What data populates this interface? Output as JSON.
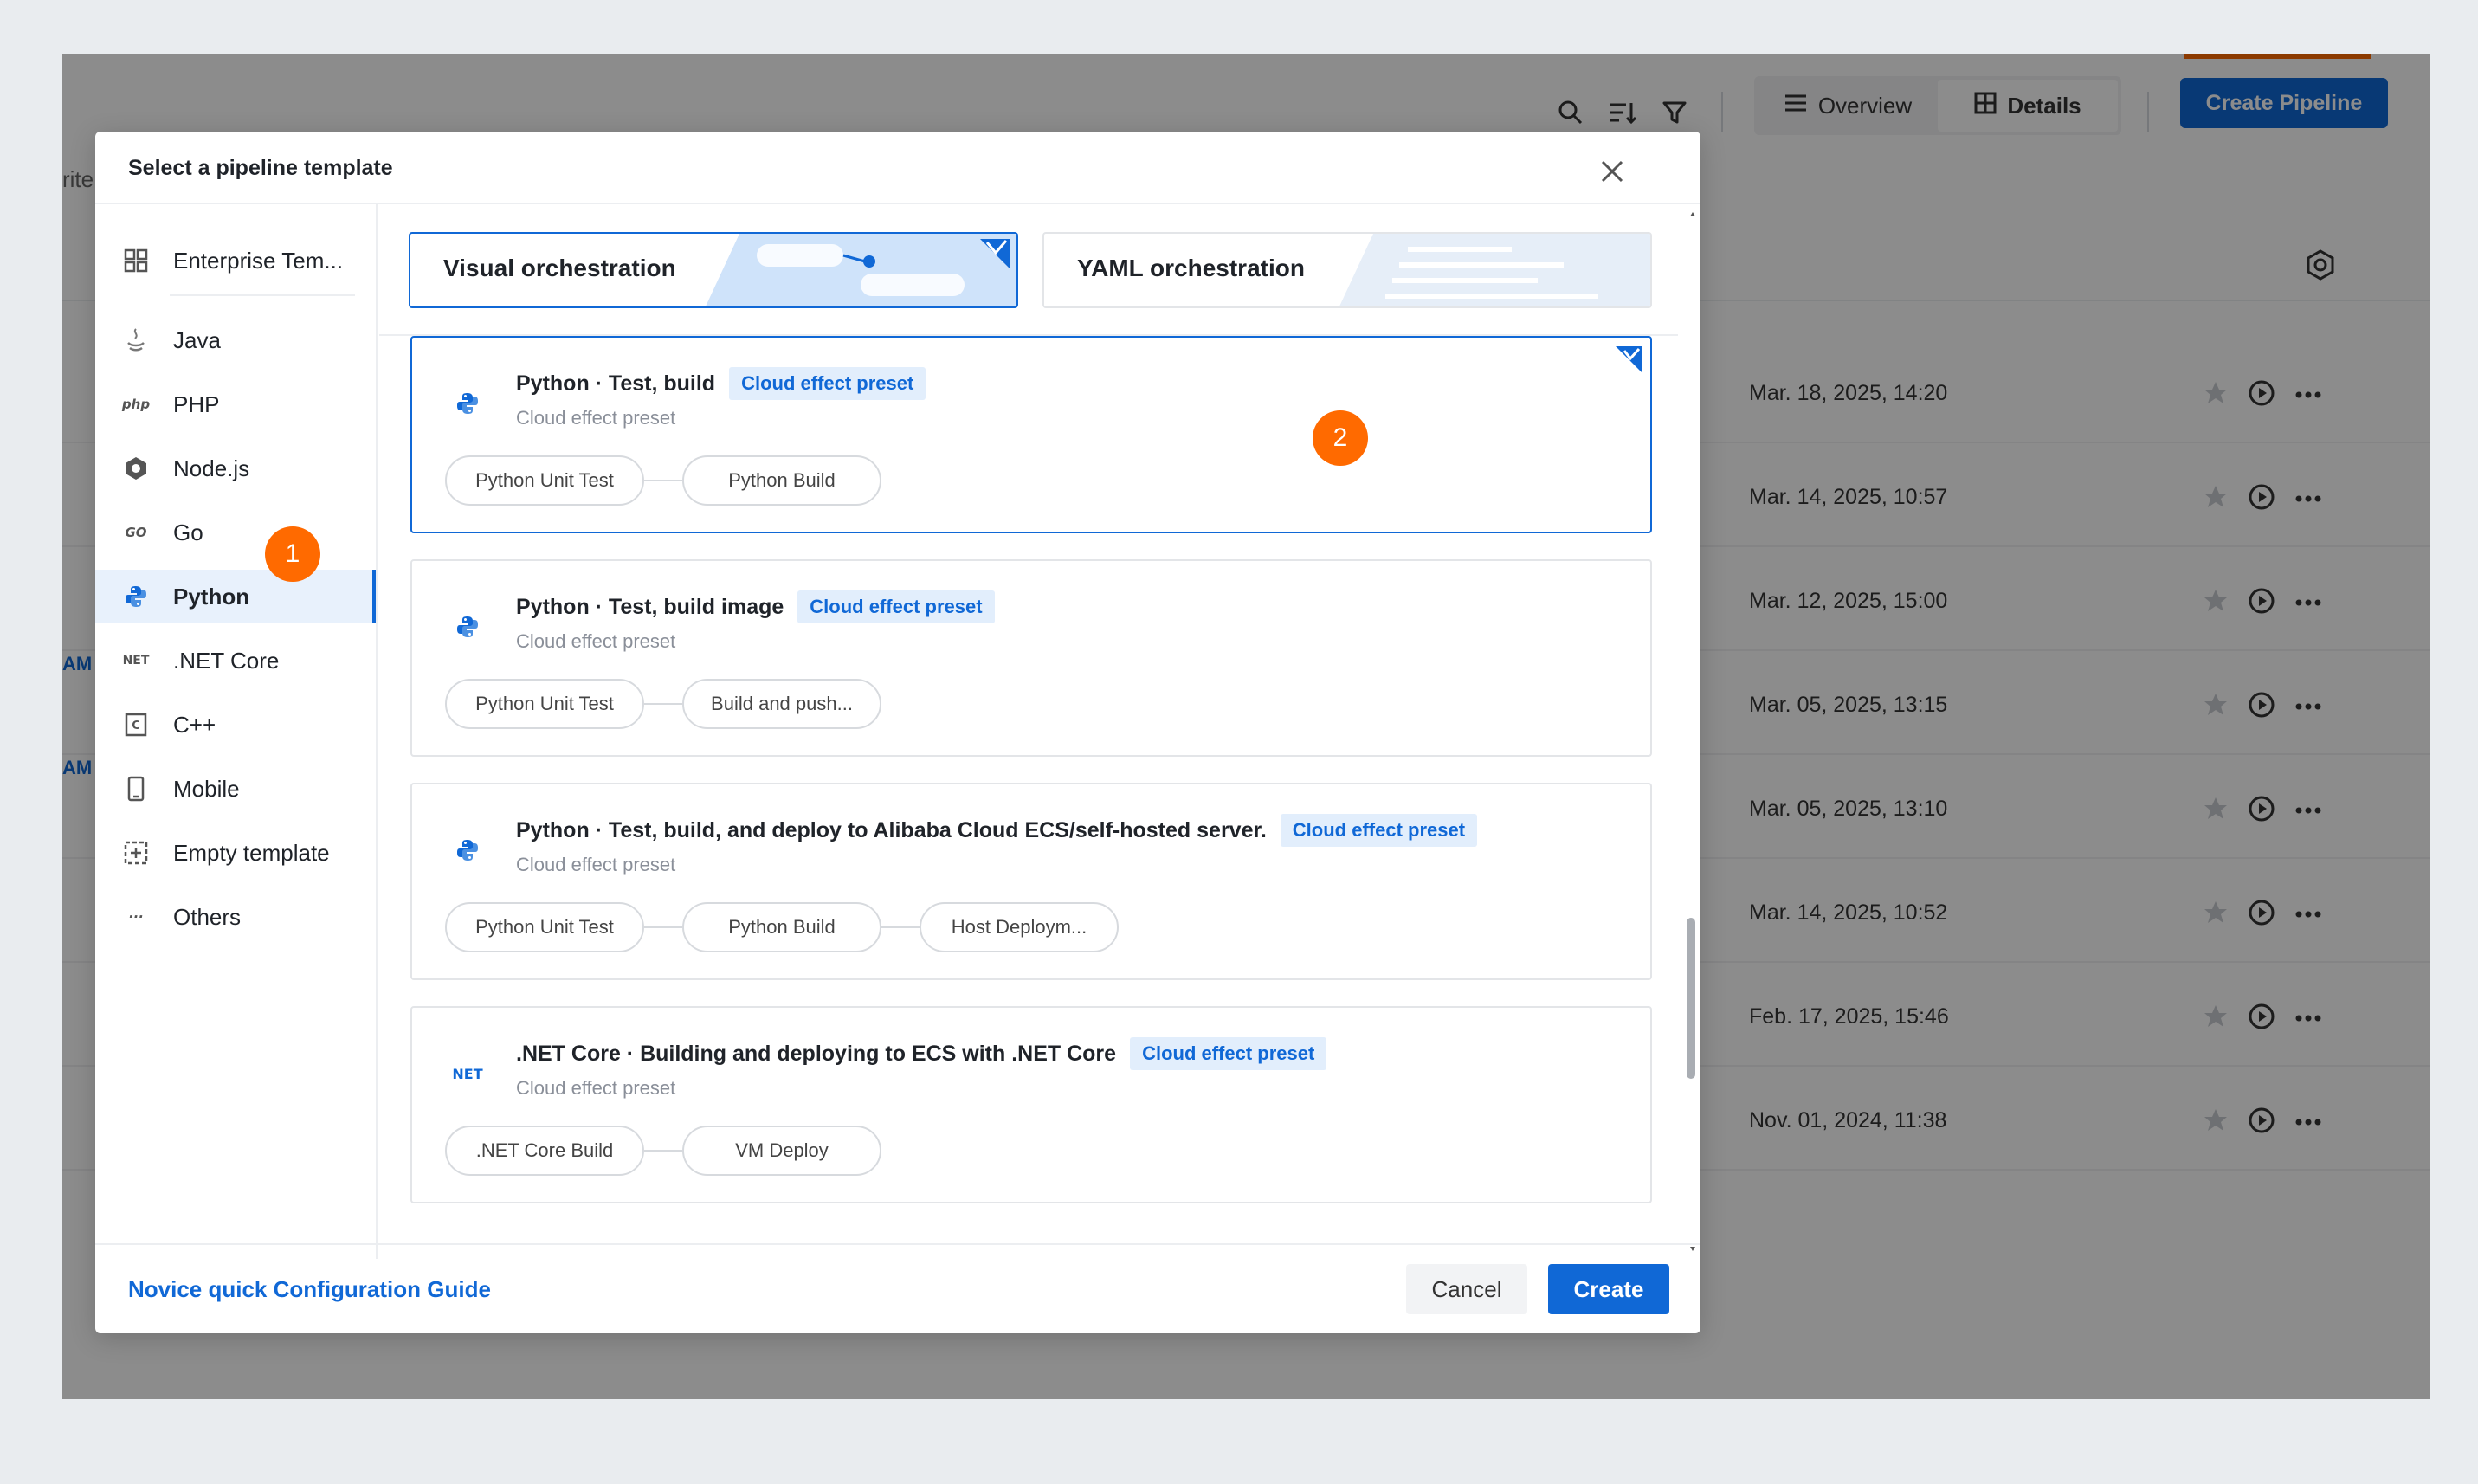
{
  "colors": {
    "accent": "#1068d6",
    "marker": "#ff6a00",
    "selected_bg": "#e8f1fc"
  },
  "background_app": {
    "view_switch": {
      "overview_label": "Overview",
      "details_label": "Details"
    },
    "create_pipeline_label": "Create Pipeline",
    "left_fragment": "rite",
    "left_tags": [
      "AM",
      "AM"
    ],
    "rows": [
      {
        "date": "Mar. 18, 2025, 14:20"
      },
      {
        "date": "Mar. 14, 2025, 10:57"
      },
      {
        "date": "Mar. 12, 2025, 15:00"
      },
      {
        "date": "Mar. 05, 2025, 13:15"
      },
      {
        "date": "Mar. 05, 2025, 13:10"
      },
      {
        "date": "Mar. 14, 2025, 10:52"
      },
      {
        "date": "Feb. 17, 2025, 15:46"
      },
      {
        "date": "Nov. 01, 2024, 11:38"
      }
    ]
  },
  "modal": {
    "title": "Select a pipeline template",
    "sidebar": {
      "items": [
        {
          "label": "Enterprise Tem...",
          "icon": "grid-icon"
        },
        {
          "label": "Java",
          "icon": "java-icon"
        },
        {
          "label": "PHP",
          "icon": "php-icon",
          "glyph": "php"
        },
        {
          "label": "Node.js",
          "icon": "nodejs-icon"
        },
        {
          "label": "Go",
          "icon": "go-icon",
          "glyph": "GO"
        },
        {
          "label": "Python",
          "icon": "python-icon",
          "active": true
        },
        {
          "label": ".NET Core",
          "icon": "dotnet-icon",
          "glyph": "NET"
        },
        {
          "label": "C++",
          "icon": "cpp-icon",
          "glyph": "C"
        },
        {
          "label": "Mobile",
          "icon": "mobile-icon"
        },
        {
          "label": "Empty template",
          "icon": "add-template-icon"
        },
        {
          "label": "Others",
          "icon": "more-icon",
          "glyph": "···"
        }
      ]
    },
    "modes": [
      {
        "label": "Visual orchestration",
        "selected": true
      },
      {
        "label": "YAML orchestration",
        "selected": false
      }
    ],
    "templates": [
      {
        "name": "Python · Test, build",
        "tag": "Cloud effect preset",
        "subtitle": "Cloud effect preset",
        "icon": "python-icon",
        "steps": [
          "Python Unit Test",
          "Python Build"
        ],
        "selected": true
      },
      {
        "name": "Python · Test, build image",
        "tag": "Cloud effect preset",
        "subtitle": "Cloud effect preset",
        "icon": "python-icon",
        "steps": [
          "Python Unit Test",
          "Build and push..."
        ],
        "selected": false
      },
      {
        "name": "Python · Test, build, and deploy to Alibaba Cloud ECS/self-hosted server.",
        "tag": "Cloud effect preset",
        "subtitle": "Cloud effect preset",
        "icon": "python-icon",
        "steps": [
          "Python Unit Test",
          "Python Build",
          "Host Deploym..."
        ],
        "selected": false
      },
      {
        "name": ".NET Core · Building and deploying to ECS with .NET Core",
        "tag": "Cloud effect preset",
        "subtitle": "Cloud effect preset",
        "icon": "dotnet-icon",
        "icon_text": "NET",
        "steps": [
          ".NET Core Build",
          "VM Deploy"
        ],
        "selected": false
      }
    ],
    "footer": {
      "guide_link": "Novice quick Configuration Guide",
      "cancel_label": "Cancel",
      "create_label": "Create"
    }
  },
  "markers": [
    "1",
    "2"
  ]
}
